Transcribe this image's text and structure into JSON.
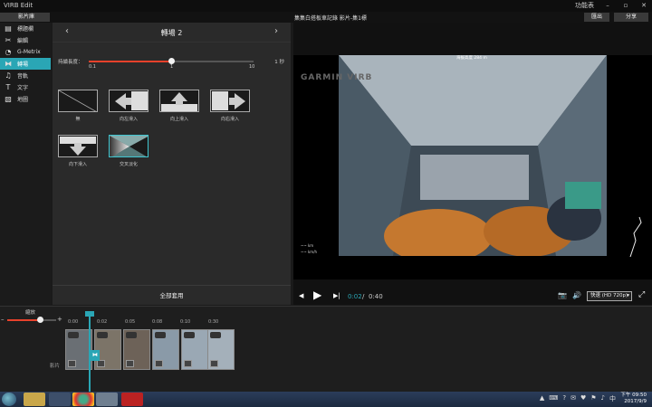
{
  "window": {
    "title": "VIRB Edit",
    "menu_label": "功能表",
    "minimize": "–",
    "maximize": "▫",
    "close": "✕"
  },
  "toolbar": {
    "back_label": "影片庫",
    "video_title": "集集白搭板車記錄 影片-集1標",
    "export_label": "匯出",
    "share_label": "分享"
  },
  "sidebar": {
    "items": [
      {
        "label": "標題欄",
        "icon": "▤"
      },
      {
        "label": "編輯",
        "icon": "✂"
      },
      {
        "label": "G-Metrix",
        "icon": "◔"
      },
      {
        "label": "轉場",
        "icon": "⧓"
      },
      {
        "label": "音軌",
        "icon": "♫"
      },
      {
        "label": "文字",
        "icon": "T"
      },
      {
        "label": "地圖",
        "icon": "▧"
      }
    ],
    "active_index": 3
  },
  "panel": {
    "title": "轉場 2",
    "prev_arrow": "‹",
    "next_arrow": "›",
    "duration": {
      "label": "持續長度：",
      "unit": "1 秒",
      "min_label": "0.1",
      "mid_label": "1",
      "max_label": "10",
      "value": 1
    },
    "transitions": [
      {
        "label": "無"
      },
      {
        "label": "向左滑入"
      },
      {
        "label": "向上滑入"
      },
      {
        "label": "向右滑入"
      },
      {
        "label": "向下滑入"
      },
      {
        "label": "交叉淡化"
      }
    ],
    "selected_transition": 5,
    "apply_all_label": "全部套用"
  },
  "preview": {
    "logo_text": "GARMIN VIRB",
    "elevation_label": "海拔高度 284 m",
    "legend_1": "~~ km",
    "legend_2": "~~ km/h",
    "current_time": "0:02",
    "separator": "/",
    "total_time": "0:40",
    "quality_label": "快速 (HD 720p)",
    "quality_arrow": "▾",
    "prev_icon": "◀",
    "play_icon": "▶",
    "next_icon": "▶|",
    "camera_icon": "📷",
    "volume_icon": "🔊",
    "fullscreen_icon": "⤢"
  },
  "timeline": {
    "zoom_label": "縮放",
    "minus": "–",
    "plus": "+",
    "ticks": [
      "0:00",
      "0:02",
      "0:05",
      "0:08",
      "0:10",
      "0:30"
    ],
    "track_label": "影片",
    "transition_marker": "⧓",
    "clip_count": 6
  },
  "taskbar": {
    "time": "下午 09:50",
    "date": "2017/9/9",
    "tray_icons": [
      "▲",
      "⌨",
      "?",
      "✉",
      "♥",
      "⚑",
      "♪",
      "中"
    ]
  }
}
